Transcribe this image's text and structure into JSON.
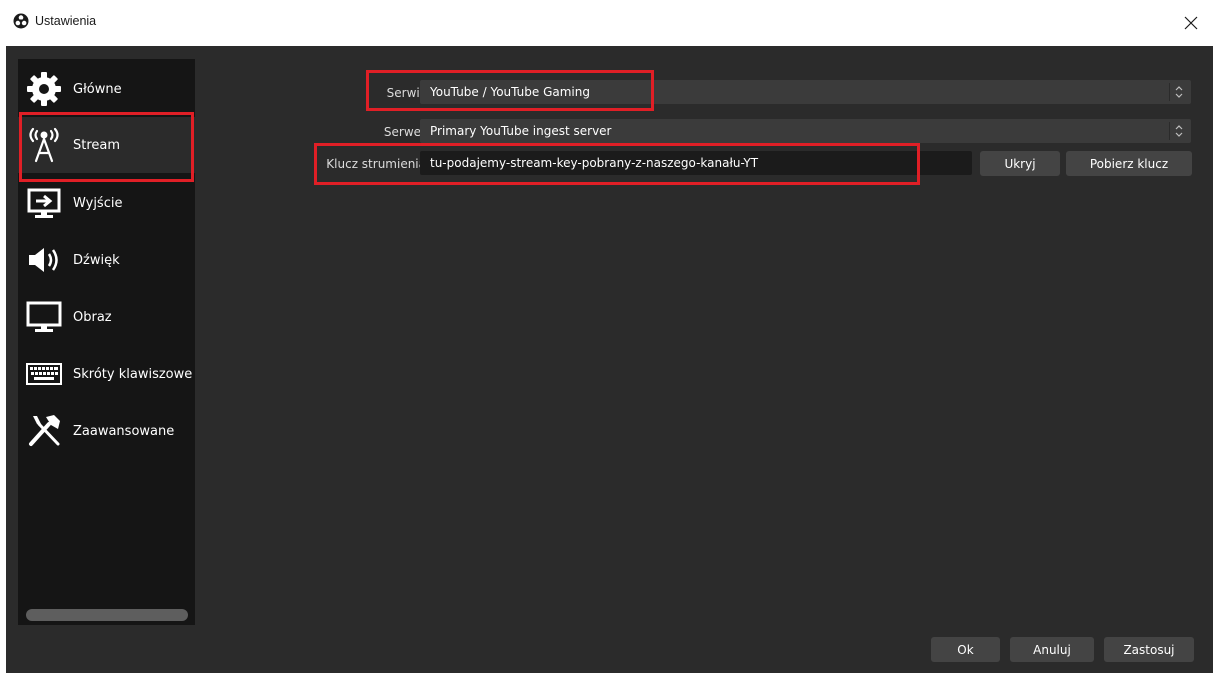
{
  "window": {
    "title": "Ustawienia"
  },
  "sidebar": {
    "items": [
      {
        "label": "Główne",
        "icon": "gear-icon"
      },
      {
        "label": "Stream",
        "icon": "broadcast-antenna-icon"
      },
      {
        "label": "Wyjście",
        "icon": "output-monitor-icon"
      },
      {
        "label": "Dźwięk",
        "icon": "speaker-icon"
      },
      {
        "label": "Obraz",
        "icon": "monitor-icon"
      },
      {
        "label": "Skróty klawiszowe",
        "icon": "keyboard-icon"
      },
      {
        "label": "Zaawansowane",
        "icon": "tools-icon"
      }
    ],
    "active": "Stream"
  },
  "stream": {
    "service_label": "Serwis",
    "service_value": "YouTube / YouTube Gaming",
    "server_label": "Serwer",
    "server_value": "Primary YouTube ingest server",
    "key_label": "Klucz strumienia",
    "key_value": "tu-podajemy-stream-key-pobrany-z-naszego-kanału-YT",
    "hide_button": "Ukryj",
    "get_key_button": "Pobierz klucz"
  },
  "footer": {
    "ok": "Ok",
    "cancel": "Anuluj",
    "apply": "Zastosuj"
  },
  "colors": {
    "highlight": "#e01f26",
    "background": "#2b2b2b",
    "sidebar": "#151515",
    "button": "#444444"
  }
}
